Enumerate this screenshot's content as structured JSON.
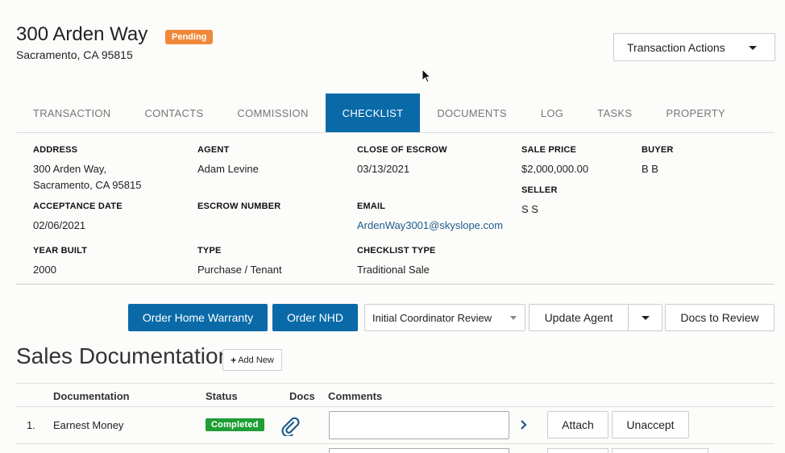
{
  "header": {
    "title": "300 Arden Way",
    "status": "Pending",
    "address": "Sacramento, CA 95815",
    "actions_label": "Transaction Actions"
  },
  "tabs": [
    {
      "label": "TRANSACTION",
      "active": false
    },
    {
      "label": "CONTACTS",
      "active": false
    },
    {
      "label": "COMMISSION",
      "active": false
    },
    {
      "label": "CHECKLIST",
      "active": true
    },
    {
      "label": "DOCUMENTS",
      "active": false
    },
    {
      "label": "LOG",
      "active": false
    },
    {
      "label": "TASKS",
      "active": false
    },
    {
      "label": "PROPERTY",
      "active": false
    }
  ],
  "details": {
    "address_label": "ADDRESS",
    "address_line1": "300 Arden Way,",
    "address_line2": "Sacramento, CA 95815",
    "agent_label": "AGENT",
    "agent": "Adam Levine",
    "close_label": "CLOSE OF ESCROW",
    "close": "03/13/2021",
    "sale_price_label": "SALE PRICE",
    "sale_price": "$2,000,000.00",
    "buyer_label": "BUYER",
    "buyer": "B B",
    "seller_label": "SELLER",
    "seller": "S S",
    "acceptance_label": "ACCEPTANCE DATE",
    "acceptance": "02/06/2021",
    "escrow_label": "ESCROW NUMBER",
    "email_label": "EMAIL",
    "email": "ArdenWay3001@skyslope.com",
    "year_label": "YEAR BUILT",
    "year": "2000",
    "type_label": "TYPE",
    "type": "Purchase / Tenant",
    "checklist_type_label": "CHECKLIST TYPE",
    "checklist_type": "Traditional Sale"
  },
  "actions": {
    "home_warranty": "Order Home Warranty",
    "nhd": "Order NHD",
    "review_select": "Initial Coordinator Review",
    "update_agent": "Update Agent",
    "docs_to_review": "Docs to Review"
  },
  "section": {
    "title": "Sales Documentation",
    "add_new": "Add New"
  },
  "table": {
    "headers": {
      "documentation": "Documentation",
      "status": "Status",
      "docs": "Docs",
      "comments": "Comments"
    },
    "rows": [
      {
        "index": "1.",
        "name": "Earnest Money",
        "status": "Completed",
        "attach": "Attach",
        "unaccept": "Unaccept"
      }
    ]
  },
  "icons": {
    "status_pending_color": "#f0883a",
    "accent_color": "#0a6aa8",
    "completed_color": "#1e9e35"
  }
}
